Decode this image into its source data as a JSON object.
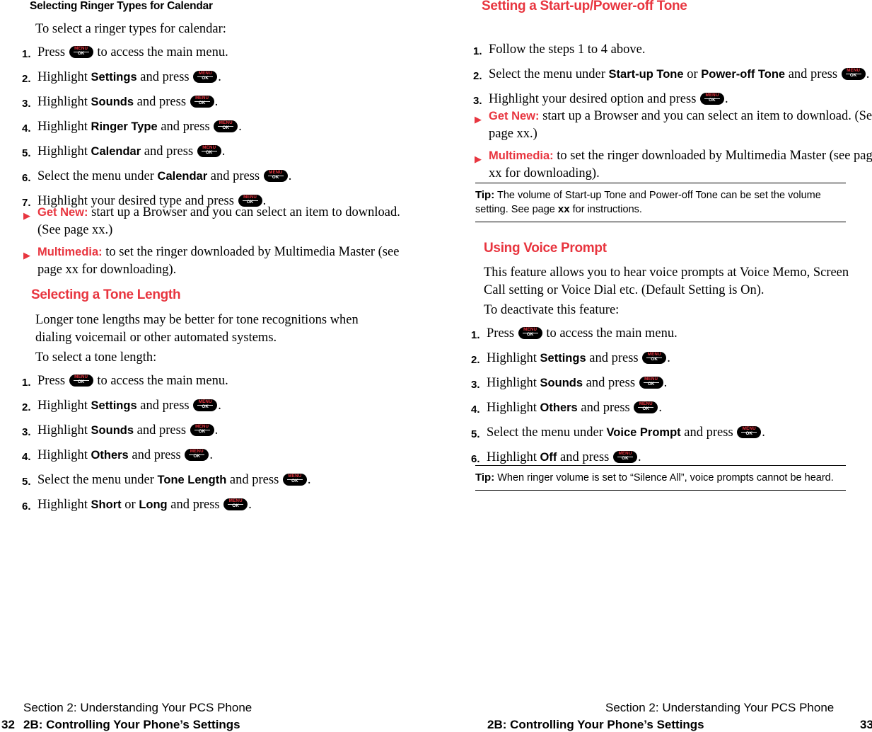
{
  "key_glyph": {
    "top": "MENU",
    "bottom": "OK",
    "name": "menu-ok-key-icon"
  },
  "left_page": {
    "heading_ringer": "Selecting Ringer Types for Calendar",
    "intro_ringer": "To select a ringer types for calendar:",
    "ringer_steps": [
      {
        "n": "1.",
        "pre": "Press ",
        "key": true,
        "post": " to access the main menu."
      },
      {
        "n": "2.",
        "pre": "Highlight ",
        "bold": "Settings",
        "mid": " and press ",
        "key": true,
        "post": "."
      },
      {
        "n": "3.",
        "pre": "Highlight ",
        "bold": "Sounds",
        "mid": " and press ",
        "key": true,
        "post": "."
      },
      {
        "n": "4.",
        "pre": "Highlight ",
        "bold": "Ringer Type",
        "mid": " and press ",
        "key": true,
        "post": "."
      },
      {
        "n": "5.",
        "pre": "Highlight ",
        "bold": "Calendar",
        "mid": " and press ",
        "key": true,
        "post": "."
      },
      {
        "n": "6.",
        "pre": "Select the menu under ",
        "bold": "Calendar",
        "mid": " and press ",
        "key": true,
        "post": "."
      },
      {
        "n": "7.",
        "pre": "Highlight your desired type and press ",
        "key": true,
        "post": "."
      }
    ],
    "ringer_bullets": [
      {
        "label": "Get New:",
        "text": " start up a Browser and you can select an item to download. (See page xx.)"
      },
      {
        "label": "Multimedia:",
        "text": " to set the ringer downloaded by Multimedia Master (see page xx for downloading)."
      }
    ],
    "heading_tone": "Selecting a Tone Length",
    "tone_para": "Longer tone lengths may be better for tone recognitions when dialing voicemail or other automated systems.",
    "tone_intro": "To select a tone length:",
    "tone_steps": [
      {
        "n": "1.",
        "pre": "Press ",
        "key": true,
        "post": " to access the main menu."
      },
      {
        "n": "2.",
        "pre": "Highlight ",
        "bold": "Settings",
        "mid": " and press ",
        "key": true,
        "post": "."
      },
      {
        "n": "3.",
        "pre": "Highlight ",
        "bold": "Sounds",
        "mid": " and press ",
        "key": true,
        "post": "."
      },
      {
        "n": "4.",
        "pre": "Highlight ",
        "bold": "Others",
        "mid": " and press ",
        "key": true,
        "post": "."
      },
      {
        "n": "5.",
        "pre": "Select the menu under ",
        "bold": "Tone Length",
        "mid": " and press ",
        "key": true,
        "post": "."
      },
      {
        "n": "6.",
        "pre": "Highlight ",
        "bold": "Short",
        "mid2": " or ",
        "bold2": "Long",
        "mid": " and press ",
        "key": true,
        "post": "."
      }
    ],
    "footer_line1": "Section 2: Understanding Your PCS Phone",
    "footer_line2": "2B: Controlling Your Phone’s Settings",
    "folio": "32"
  },
  "right_page": {
    "heading_startup": "Setting a Start-up/Power-off Tone",
    "startup_steps": [
      {
        "n": "1.",
        "pre": "Follow the steps 1 to 4 above."
      },
      {
        "n": "2.",
        "pre": "Select the menu under ",
        "bold": "Start-up Tone",
        "mid2": " or ",
        "bold2": "Power-off Tone",
        "mid": " and press ",
        "key": true,
        "post": "."
      },
      {
        "n": "3.",
        "pre": "Highlight your desired option and press ",
        "key": true,
        "post": "."
      }
    ],
    "startup_bullets": [
      {
        "label": "Get New:",
        "text": " start up a Browser and you can select an item to download. (See page xx.)"
      },
      {
        "label": "Multimedia:",
        "text": " to set the ringer downloaded by Multimedia Master (see page xx for downloading)."
      }
    ],
    "tip1": {
      "label": "Tip:",
      "text_before": " The volume of Start-up Tone and Power-off Tone can be set the volume setting. See page ",
      "bold": "xx",
      "text_after": " for instructions."
    },
    "heading_voice": "Using Voice Prompt",
    "voice_para": "This feature allows you to hear voice prompts at Voice Memo, Screen Call setting or Voice Dial etc. (Default Setting is On).",
    "voice_intro": "To deactivate this feature:",
    "voice_steps": [
      {
        "n": "1.",
        "pre": "Press ",
        "key": true,
        "post": " to access the main menu."
      },
      {
        "n": "2.",
        "pre": "Highlight ",
        "bold": "Settings",
        "mid": " and press ",
        "key": true,
        "post": "."
      },
      {
        "n": "3.",
        "pre": "Highlight ",
        "bold": "Sounds",
        "mid": " and press ",
        "key": true,
        "post": "."
      },
      {
        "n": "4.",
        "pre": "Highlight ",
        "bold": "Others",
        "mid": " and press ",
        "key": true,
        "post": "."
      },
      {
        "n": "5.",
        "pre": "Select the menu under ",
        "bold": "Voice Prompt",
        "mid": " and press ",
        "key": true,
        "post": "."
      },
      {
        "n": "6.",
        "pre": "Highlight ",
        "bold": "Off",
        "mid": " and press ",
        "key": true,
        "post": "."
      }
    ],
    "tip2": {
      "label": "Tip:",
      "text_before": " When ringer volume is set to “Silence All”, voice prompts cannot be heard.",
      "bold": "",
      "text_after": ""
    },
    "footer_line1": "Section 2: Understanding Your PCS Phone",
    "footer_line2": "2B: Controlling Your Phone’s Settings",
    "folio": "33"
  }
}
